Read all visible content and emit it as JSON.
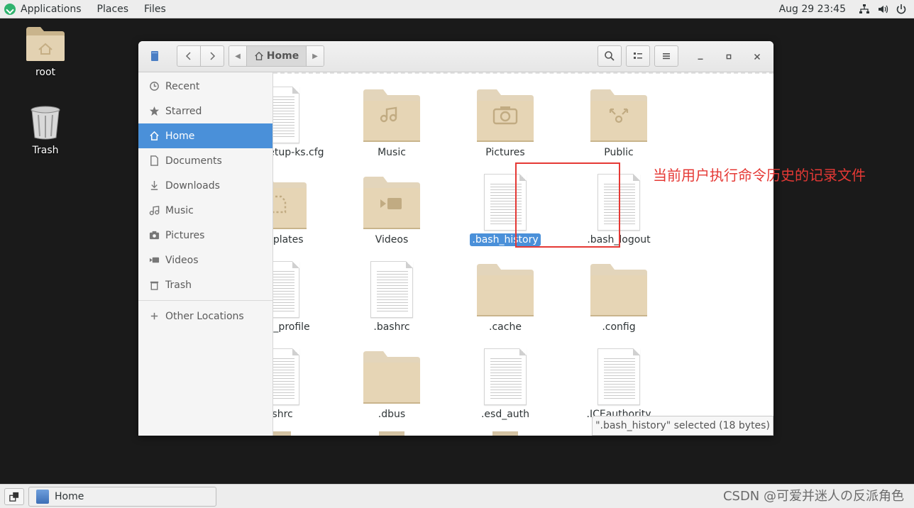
{
  "topbar": {
    "applications": "Applications",
    "places": "Places",
    "files": "Files",
    "clock": "Aug 29  23:45",
    "icons": [
      "network-icon",
      "volume-icon",
      "power-icon"
    ]
  },
  "desktop": {
    "items": [
      {
        "label": "root",
        "icon": "home-folder-icon"
      },
      {
        "label": "Trash",
        "icon": "trash-can-icon"
      }
    ]
  },
  "window": {
    "path": "Home"
  },
  "sidebar": {
    "items": [
      {
        "label": "Recent",
        "icon": "clock-icon"
      },
      {
        "label": "Starred",
        "icon": "star-icon"
      },
      {
        "label": "Home",
        "icon": "home-icon",
        "active": true
      },
      {
        "label": "Documents",
        "icon": "document-icon"
      },
      {
        "label": "Downloads",
        "icon": "download-icon"
      },
      {
        "label": "Music",
        "icon": "music-icon"
      },
      {
        "label": "Pictures",
        "icon": "camera-icon"
      },
      {
        "label": "Videos",
        "icon": "video-icon"
      },
      {
        "label": "Trash",
        "icon": "trash-icon"
      }
    ],
    "other_locations": "Other Locations"
  },
  "files": [
    {
      "name": "initial-setup-ks.cfg",
      "type": "document"
    },
    {
      "name": "Music",
      "type": "folder",
      "emblem": "music"
    },
    {
      "name": "Pictures",
      "type": "folder",
      "emblem": "camera"
    },
    {
      "name": "Public",
      "type": "folder",
      "emblem": "share"
    },
    {
      "name": "Templates",
      "type": "folder",
      "emblem": "template"
    },
    {
      "name": "Videos",
      "type": "folder",
      "emblem": "video"
    },
    {
      "name": ".bash_history",
      "type": "document",
      "selected": true
    },
    {
      "name": ".bash_logout",
      "type": "document"
    },
    {
      "name": ".bash_profile",
      "type": "document"
    },
    {
      "name": ".bashrc",
      "type": "document"
    },
    {
      "name": ".cache",
      "type": "folder"
    },
    {
      "name": ".config",
      "type": "folder"
    },
    {
      "name": ".cshrc",
      "type": "document"
    },
    {
      "name": ".dbus",
      "type": "folder"
    },
    {
      "name": ".esd_auth",
      "type": "document"
    },
    {
      "name": ".ICEauthority",
      "type": "document"
    }
  ],
  "annotation": "当前用户执行命令历史的记录文件",
  "status": "\".bash_history\" selected  (18 bytes)",
  "taskbar": {
    "window_label": "Home",
    "watermark": "CSDN @可爱并迷人の反派角色"
  },
  "colors": {
    "selection": "#4a90d9",
    "annotation": "#e53935",
    "folder": "#d9c7a4"
  }
}
